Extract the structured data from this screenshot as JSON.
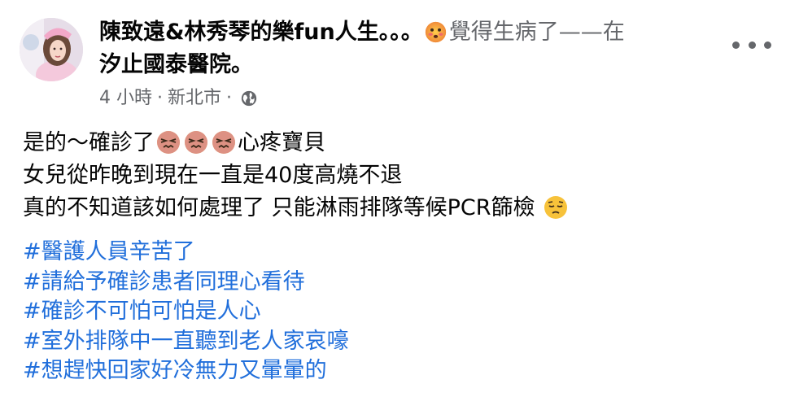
{
  "post": {
    "author": "陳致遠&林秀琴的樂fun人生",
    "separator": "。。。",
    "feeling_text": "覺得生病了",
    "dash": "——",
    "location_prefix": "在",
    "location": "汐止國泰醫院",
    "location_suffix": "。",
    "feeling_icon": "sick-face-emoji",
    "time": "4 小時",
    "place": "新北市",
    "meta_dot": "·",
    "privacy_icon": "globe-icon",
    "body_lines": {
      "line1_a": "是的～確診了",
      "line1_b": "心疼寶貝",
      "line2": "女兒從昨晚到現在一直是40度高燒不退",
      "line3": "真的不知道該如何處理了 只能淋雨排隊等候PCR篩檢"
    },
    "hashtags": [
      "#醫護人員辛苦了",
      "#請給予確診患者同理心看待",
      "#確診不可怕可怕是人心",
      "#室外排隊中一直聽到老人家哀嚎",
      "#想趕快回家好冷無力又暈暈的"
    ]
  },
  "colors": {
    "text": "#050505",
    "secondary": "#65676b",
    "link": "#216fdb",
    "emoji_face": "#f7c23a"
  }
}
